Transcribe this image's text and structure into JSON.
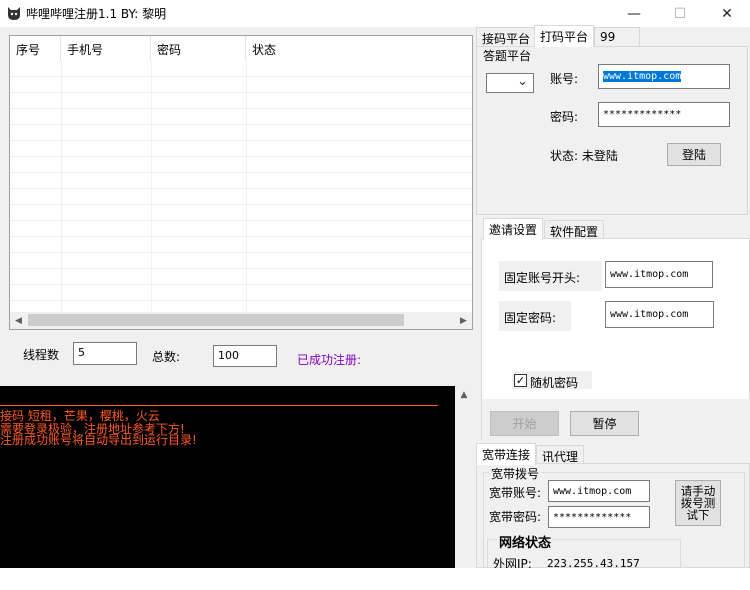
{
  "window": {
    "title": "哔哩哔哩注册1.1   BY: 黎明",
    "controls": {
      "minimize": "—",
      "maximize": "☐",
      "close": "✕"
    }
  },
  "list": {
    "columns": [
      "序号",
      "手机号",
      "密码",
      "状态"
    ],
    "rows": []
  },
  "controls": {
    "threads_label": "线程数",
    "threads_value": "5",
    "total_label": "总数:",
    "total_value": "100",
    "success_label": "已成功注册:"
  },
  "console": {
    "lines": [
      "接码 短租，芒果，樱桃，火云",
      "需要登录极验，注册地址参考下方!",
      "注册成功账号将自动导出到运行目录!"
    ]
  },
  "captcha_tabs": {
    "tabs": [
      "接码平台",
      "打码平台",
      "99"
    ],
    "active": "打码平台",
    "group_label": "答题平台",
    "account_label": "账号:",
    "account_value": "www.itmop.com",
    "password_label": "密码:",
    "password_value": "*************",
    "status_label": "状态: 未登陆",
    "login_button": "登陆"
  },
  "config_tabs": {
    "tabs": [
      "邀请设置",
      "软件配置"
    ],
    "active": "邀请设置",
    "prefix_label": "固定账号开头:",
    "prefix_value": "www.itmop.com",
    "fixed_pwd_label": "固定密码:",
    "fixed_pwd_value": "www.itmop.com",
    "random_pwd_label": "随机密码",
    "random_pwd_checked": true,
    "start_button": "开始",
    "pause_button": "暂停"
  },
  "broadband_tabs": {
    "tabs": [
      "宽带连接",
      "讯代理"
    ],
    "active": "宽带连接",
    "group_label": "宽带拨号",
    "account_label": "宽带账号:",
    "account_value": "www.itmop.com",
    "password_label": "宽带密码:",
    "password_value": "*************",
    "manual_dial_button": "请手动拨号测试下",
    "network_group_label": "网络状态",
    "ip_label": "外网IP:",
    "ip_value": "223.255.43.157"
  },
  "icons": {
    "app": "cat-head-icon",
    "scroll_left": "◀",
    "scroll_right": "▶",
    "scroll_up": "▲",
    "scroll_down": "▼",
    "combo_arrow": "⌄",
    "check": "✓"
  },
  "colors": {
    "console_text": "#ff5a28",
    "success_text": "#8000c0",
    "selection": "#0078d7"
  }
}
